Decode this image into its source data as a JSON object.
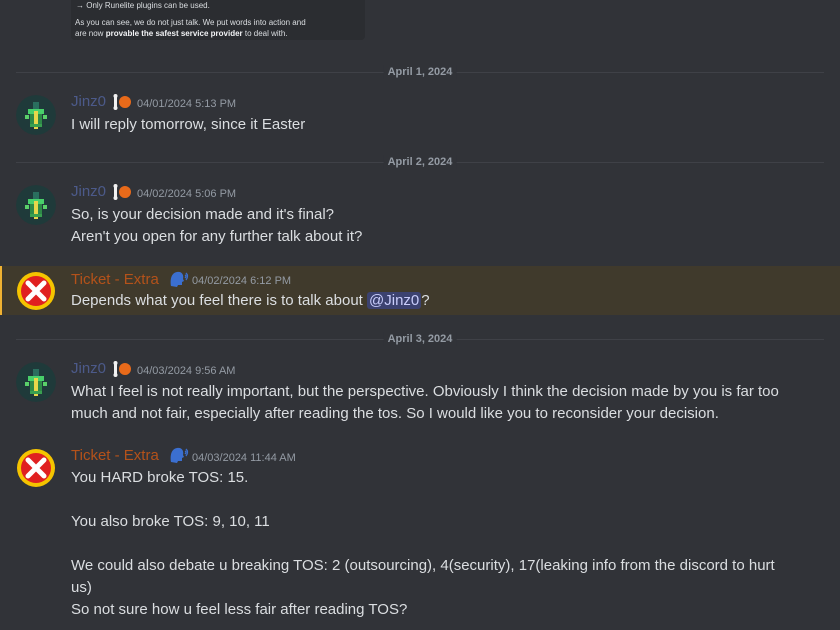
{
  "embed": {
    "line1": "→ Only Runelite plugins can be used.",
    "line2": "As you can see, we do not just talk. We put words into action and",
    "line3_pre": "are now ",
    "line3_bold": "provable the safest service provider",
    "line3_post": " to deal with."
  },
  "dates": [
    "April 1, 2024",
    "April 2, 2024",
    "April 3, 2024"
  ],
  "messages": [
    {
      "author": "Jinz0",
      "timestamp": "04/01/2024 5:13 PM",
      "text": "I will reply tomorrow, since it Easter"
    },
    {
      "author": "Jinz0",
      "timestamp": "04/02/2024 5:06 PM",
      "text": "So, is your decision made and it's final?\nAren't you open for any further talk about it?"
    },
    {
      "author": "Ticket - Extra",
      "timestamp": "04/02/2024 6:12 PM",
      "text": "Depends what you feel there is to talk about ",
      "mention": "@Jinz0",
      "text_after": "?"
    },
    {
      "author": "Jinz0",
      "timestamp": "04/03/2024 9:56 AM",
      "text": "What I feel is not really important, but the perspective. Obviously I think the decision made by you is far too much and not fair, especially after reading the tos. So I would like you to reconsider your decision."
    },
    {
      "author": "Ticket - Extra",
      "timestamp": "04/03/2024 11:44 AM",
      "text": "You HARD broke TOS: 15.\n\nYou also broke TOS: 9, 10, 11\n\nWe could also debate u breaking TOS: 2 (outsourcing), 4(security), 17(leaking info from the discord to hurt us)\nSo not sure how u feel less fair after reading TOS?"
    }
  ],
  "colors": {
    "background": "#313338",
    "jinz_name": "#4c5a8a",
    "ticket_name": "#b4521a",
    "highlight": "#403a2c",
    "highlight_bar": "#f0b232"
  },
  "icons": {
    "jinz_avatar": "pixel-character-avatar",
    "ticket_avatar": "red-x-avatar",
    "jinz_badge": "bone-badge-icon",
    "ticket_badge": "speaking-head-icon"
  }
}
